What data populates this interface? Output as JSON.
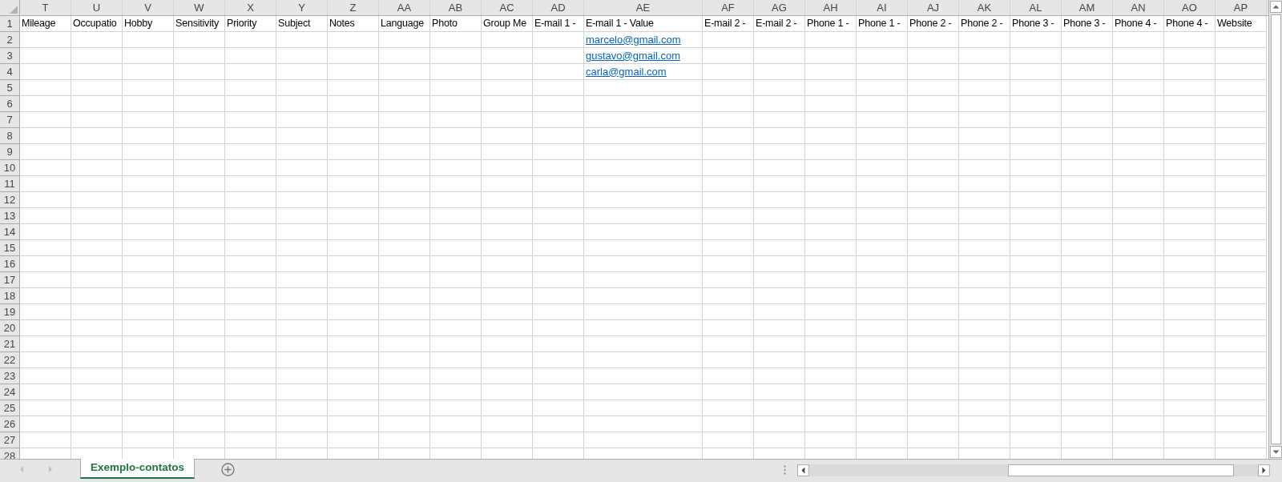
{
  "columns": [
    {
      "letter": "T",
      "wide": false
    },
    {
      "letter": "U",
      "wide": false
    },
    {
      "letter": "V",
      "wide": false
    },
    {
      "letter": "W",
      "wide": false
    },
    {
      "letter": "X",
      "wide": false
    },
    {
      "letter": "Y",
      "wide": false
    },
    {
      "letter": "Z",
      "wide": false
    },
    {
      "letter": "AA",
      "wide": false
    },
    {
      "letter": "AB",
      "wide": false
    },
    {
      "letter": "AC",
      "wide": false
    },
    {
      "letter": "AD",
      "wide": false
    },
    {
      "letter": "AE",
      "wide": true
    },
    {
      "letter": "AF",
      "wide": false
    },
    {
      "letter": "AG",
      "wide": false
    },
    {
      "letter": "AH",
      "wide": false
    },
    {
      "letter": "AI",
      "wide": false
    },
    {
      "letter": "AJ",
      "wide": false
    },
    {
      "letter": "AK",
      "wide": false
    },
    {
      "letter": "AL",
      "wide": false
    },
    {
      "letter": "AM",
      "wide": false
    },
    {
      "letter": "AN",
      "wide": false
    },
    {
      "letter": "AO",
      "wide": false
    },
    {
      "letter": "AP",
      "wide": false
    }
  ],
  "rows": [
    {
      "number": "1",
      "cells": [
        {
          "text": "Mileage",
          "kind": "text"
        },
        {
          "text": "Occupatio",
          "kind": "text"
        },
        {
          "text": "Hobby",
          "kind": "text"
        },
        {
          "text": "Sensitivity",
          "kind": "text"
        },
        {
          "text": "Priority",
          "kind": "text"
        },
        {
          "text": "Subject",
          "kind": "text"
        },
        {
          "text": "Notes",
          "kind": "text"
        },
        {
          "text": "Language",
          "kind": "text"
        },
        {
          "text": "Photo",
          "kind": "text"
        },
        {
          "text": "Group Me",
          "kind": "text"
        },
        {
          "text": "E-mail 1 -",
          "kind": "text"
        },
        {
          "text": "E-mail 1 - Value",
          "kind": "text"
        },
        {
          "text": "E-mail 2 -",
          "kind": "text"
        },
        {
          "text": "E-mail 2 -",
          "kind": "text"
        },
        {
          "text": "Phone 1 -",
          "kind": "text"
        },
        {
          "text": "Phone 1 -",
          "kind": "text"
        },
        {
          "text": "Phone 2 -",
          "kind": "text"
        },
        {
          "text": "Phone 2 -",
          "kind": "text"
        },
        {
          "text": "Phone 3 -",
          "kind": "text"
        },
        {
          "text": "Phone 3 -",
          "kind": "text"
        },
        {
          "text": "Phone 4 -",
          "kind": "text"
        },
        {
          "text": "Phone 4 -",
          "kind": "text"
        },
        {
          "text": "Website",
          "kind": "text"
        }
      ]
    },
    {
      "number": "2",
      "cells": [
        {
          "kind": "empty"
        },
        {
          "kind": "empty"
        },
        {
          "kind": "empty"
        },
        {
          "kind": "empty"
        },
        {
          "kind": "empty"
        },
        {
          "kind": "empty"
        },
        {
          "kind": "empty"
        },
        {
          "kind": "empty"
        },
        {
          "kind": "empty"
        },
        {
          "kind": "empty"
        },
        {
          "kind": "empty"
        },
        {
          "text": "marcelo@gmail.com",
          "kind": "link"
        }
      ]
    },
    {
      "number": "3",
      "cells": [
        {
          "kind": "empty"
        },
        {
          "kind": "empty"
        },
        {
          "kind": "empty"
        },
        {
          "kind": "empty"
        },
        {
          "kind": "empty"
        },
        {
          "kind": "empty"
        },
        {
          "kind": "empty"
        },
        {
          "kind": "empty"
        },
        {
          "kind": "empty"
        },
        {
          "kind": "empty"
        },
        {
          "kind": "empty"
        },
        {
          "text": "gustavo@gmail.com",
          "kind": "link"
        }
      ]
    },
    {
      "number": "4",
      "cells": [
        {
          "kind": "empty"
        },
        {
          "kind": "empty"
        },
        {
          "kind": "empty"
        },
        {
          "kind": "empty"
        },
        {
          "kind": "empty"
        },
        {
          "kind": "empty"
        },
        {
          "kind": "empty"
        },
        {
          "kind": "empty"
        },
        {
          "kind": "empty"
        },
        {
          "kind": "empty"
        },
        {
          "kind": "empty"
        },
        {
          "text": "carla@gmail.com",
          "kind": "link"
        }
      ]
    },
    {
      "number": "5"
    },
    {
      "number": "6"
    },
    {
      "number": "7"
    },
    {
      "number": "8"
    },
    {
      "number": "9"
    },
    {
      "number": "10"
    },
    {
      "number": "11"
    },
    {
      "number": "12"
    },
    {
      "number": "13"
    },
    {
      "number": "14"
    },
    {
      "number": "15"
    },
    {
      "number": "16"
    },
    {
      "number": "17"
    },
    {
      "number": "18"
    },
    {
      "number": "19"
    },
    {
      "number": "20"
    },
    {
      "number": "21"
    },
    {
      "number": "22"
    },
    {
      "number": "23"
    },
    {
      "number": "24"
    },
    {
      "number": "25"
    },
    {
      "number": "26"
    },
    {
      "number": "27"
    },
    {
      "number": "28"
    }
  ],
  "sheet_tabs": [
    {
      "label": "Exemplo-contatos",
      "selected": true
    }
  ]
}
